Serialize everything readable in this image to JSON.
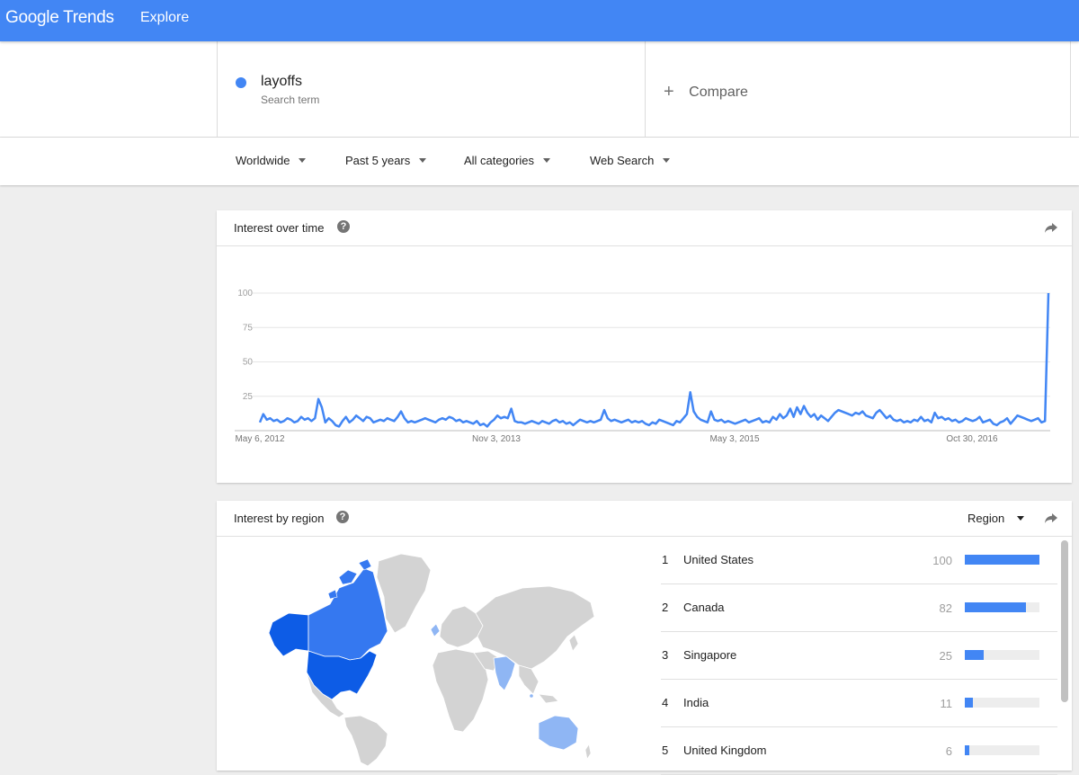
{
  "header": {
    "logo_google": "Google",
    "logo_trends": "Trends",
    "explore": "Explore"
  },
  "term": {
    "name": "layoffs",
    "type": "Search term",
    "color": "#4286f4"
  },
  "compare": {
    "label": "Compare"
  },
  "filters": [
    {
      "label": "Worldwide"
    },
    {
      "label": "Past 5 years"
    },
    {
      "label": "All categories"
    },
    {
      "label": "Web Search"
    }
  ],
  "interest_over_time": {
    "title": "Interest over time",
    "chart_data": {
      "type": "line",
      "ylim": [
        0,
        100
      ],
      "yticks": [
        "100",
        "75",
        "50",
        "25"
      ],
      "xticks": [
        "May 6, 2012",
        "Nov 3, 2013",
        "May 3, 2015",
        "Oct 30, 2016"
      ],
      "series": [
        {
          "color": "#4286f4",
          "values": [
            6,
            12,
            8,
            9,
            7,
            8,
            6,
            7,
            9,
            8,
            6,
            7,
            10,
            8,
            9,
            7,
            9,
            23,
            17,
            6,
            9,
            7,
            4,
            3,
            7,
            10,
            6,
            8,
            11,
            9,
            7,
            10,
            9,
            6,
            7,
            8,
            7,
            9,
            8,
            7,
            10,
            14,
            9,
            6,
            7,
            6,
            7,
            8,
            9,
            8,
            7,
            6,
            8,
            9,
            8,
            10,
            9,
            7,
            8,
            6,
            7,
            6,
            5,
            7,
            4,
            5,
            3,
            6,
            8,
            11,
            9,
            10,
            9,
            16,
            7,
            6,
            6,
            5,
            6,
            7,
            6,
            5,
            7,
            6,
            5,
            7,
            8,
            6,
            7,
            5,
            6,
            4,
            6,
            8,
            7,
            6,
            7,
            6,
            7,
            8,
            15,
            9,
            7,
            8,
            7,
            6,
            7,
            8,
            6,
            7,
            6,
            7,
            5,
            4,
            6,
            5,
            8,
            7,
            6,
            5,
            4,
            7,
            6,
            9,
            12,
            28,
            14,
            10,
            8,
            7,
            6,
            14,
            8,
            7,
            8,
            6,
            7,
            6,
            5,
            6,
            7,
            8,
            6,
            7,
            8,
            9,
            6,
            7,
            6,
            10,
            8,
            12,
            9,
            11,
            16,
            10,
            17,
            12,
            18,
            13,
            10,
            12,
            8,
            11,
            9,
            7,
            10,
            13,
            15,
            14,
            13,
            12,
            11,
            13,
            12,
            14,
            11,
            10,
            9,
            13,
            15,
            12,
            9,
            11,
            8,
            7,
            8,
            6,
            7,
            6,
            8,
            7,
            10,
            7,
            8,
            6,
            13,
            9,
            10,
            8,
            9,
            7,
            8,
            6,
            7,
            9,
            8,
            7,
            8,
            10,
            6,
            7,
            8,
            5,
            4,
            6,
            7,
            9,
            5,
            8,
            11,
            10,
            9,
            8,
            7,
            8,
            9,
            6,
            7,
            100
          ]
        }
      ]
    }
  },
  "interest_by_region": {
    "title": "Interest by region",
    "selector": "Region",
    "map_colors": {
      "dark": "#0d5ce6",
      "mid": "#3578f0",
      "light": "#8fb6f4",
      "none": "#d3d3d3"
    },
    "regions": [
      {
        "rank": "1",
        "name": "United States",
        "value": "100",
        "fraction": 1.0
      },
      {
        "rank": "2",
        "name": "Canada",
        "value": "82",
        "fraction": 0.82
      },
      {
        "rank": "3",
        "name": "Singapore",
        "value": "25",
        "fraction": 0.25
      },
      {
        "rank": "4",
        "name": "India",
        "value": "11",
        "fraction": 0.11
      },
      {
        "rank": "5",
        "name": "United Kingdom",
        "value": "6",
        "fraction": 0.06
      }
    ]
  }
}
